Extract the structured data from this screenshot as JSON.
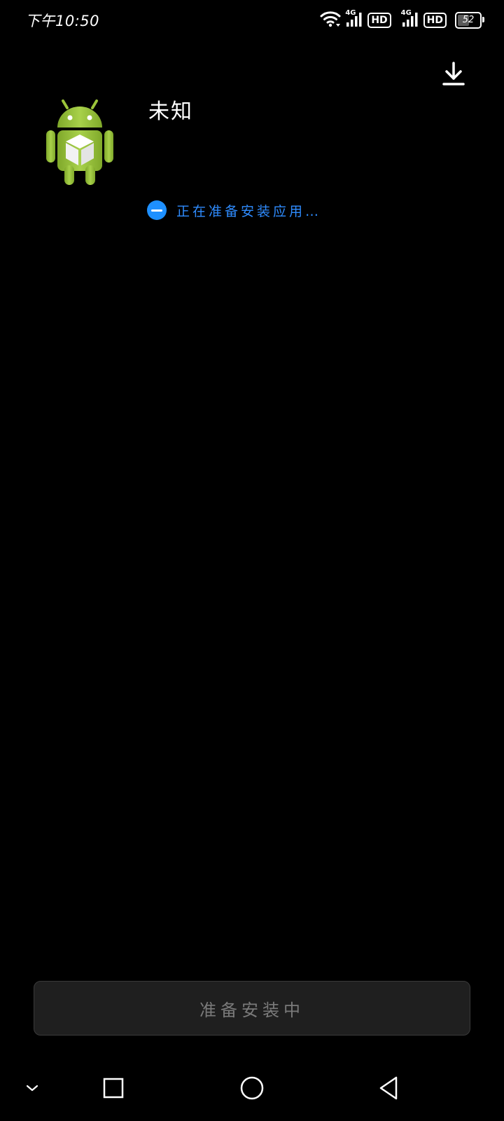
{
  "status_bar": {
    "time": "下午10:50",
    "sim1_network": "4G",
    "sim1_hd": "HD",
    "sim2_network": "4G",
    "sim2_hd": "HD",
    "battery_level": "52",
    "icons": [
      "wifi-icon",
      "signal-icon",
      "signal-icon",
      "battery-icon"
    ]
  },
  "header": {
    "download_icon": "download-icon"
  },
  "app": {
    "name": "未知",
    "icon": "android-package-icon",
    "status_text": "正在准备安装应用…"
  },
  "footer": {
    "button_label": "准备安装中"
  },
  "nav": {
    "icons": [
      "chevron-down-icon",
      "recents-square-icon",
      "home-circle-icon",
      "back-triangle-icon"
    ]
  },
  "colors": {
    "background": "#000000",
    "accent_blue": "#2f8cff",
    "spinner_blue": "#1e90ff",
    "android_green": "#9bc43a",
    "button_bg": "#1f1f1f",
    "button_text": "#7a7a7a"
  }
}
